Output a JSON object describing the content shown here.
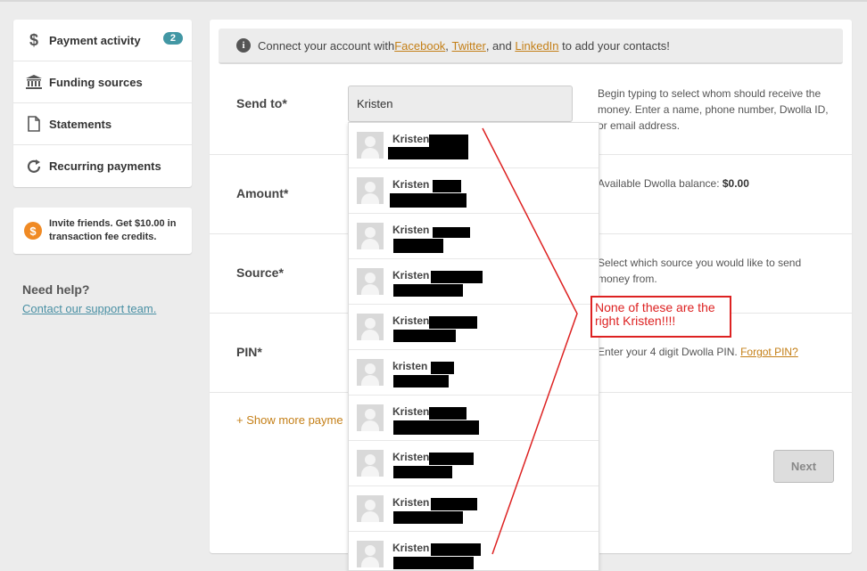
{
  "sidebar": {
    "items": [
      {
        "label": "Payment activity",
        "icon": "dollar-icon",
        "badge": "2"
      },
      {
        "label": "Funding sources",
        "icon": "bank-icon"
      },
      {
        "label": "Statements",
        "icon": "document-icon"
      },
      {
        "label": "Recurring payments",
        "icon": "refresh-icon"
      }
    ],
    "invite": {
      "icon_text": "$",
      "text": "Invite friends. Get $10.00 in transaction fee credits."
    },
    "help_title": "Need help?",
    "help_link": "Contact our support team."
  },
  "notice": {
    "prefix": "Connect your account with ",
    "facebook": "Facebook",
    "comma1": ", ",
    "twitter": "Twitter",
    "and": ", and ",
    "linkedin": "LinkedIn",
    "suffix": " to add your contacts!"
  },
  "form": {
    "send_to_label": "Send to*",
    "send_to_value": "Kristen",
    "send_to_hint": "Begin typing to select whom should receive the money. Enter a name, phone number, Dwolla ID, or email address.",
    "amount_label": "Amount*",
    "balance_label": "Available Dwolla balance: ",
    "balance_value": "$0.00",
    "source_label": "Source*",
    "source_hint": "Select which source you would like to send money from.",
    "pin_label": "PIN*",
    "pin_hint": "Enter your 4 digit Dwolla PIN. ",
    "forgot_pin": "Forgot PIN?",
    "show_more": "+ Show more payme",
    "next_label": "Next"
  },
  "suggestions": [
    {
      "name": "Kristen"
    },
    {
      "name": "Kristen"
    },
    {
      "name": "Kristen"
    },
    {
      "name": "Kristen"
    },
    {
      "name": "Kristen"
    },
    {
      "name": "kristen"
    },
    {
      "name": "Kristen"
    },
    {
      "name": "Kristen"
    },
    {
      "name": "Kristen"
    },
    {
      "name": "Kristen"
    }
  ],
  "annotation": {
    "text": "None of these are the right Kristen!!!!",
    "color": "#dd2222"
  },
  "colors": {
    "link": "#c47f17",
    "badge": "#4297a4",
    "coin": "#f08a24"
  }
}
